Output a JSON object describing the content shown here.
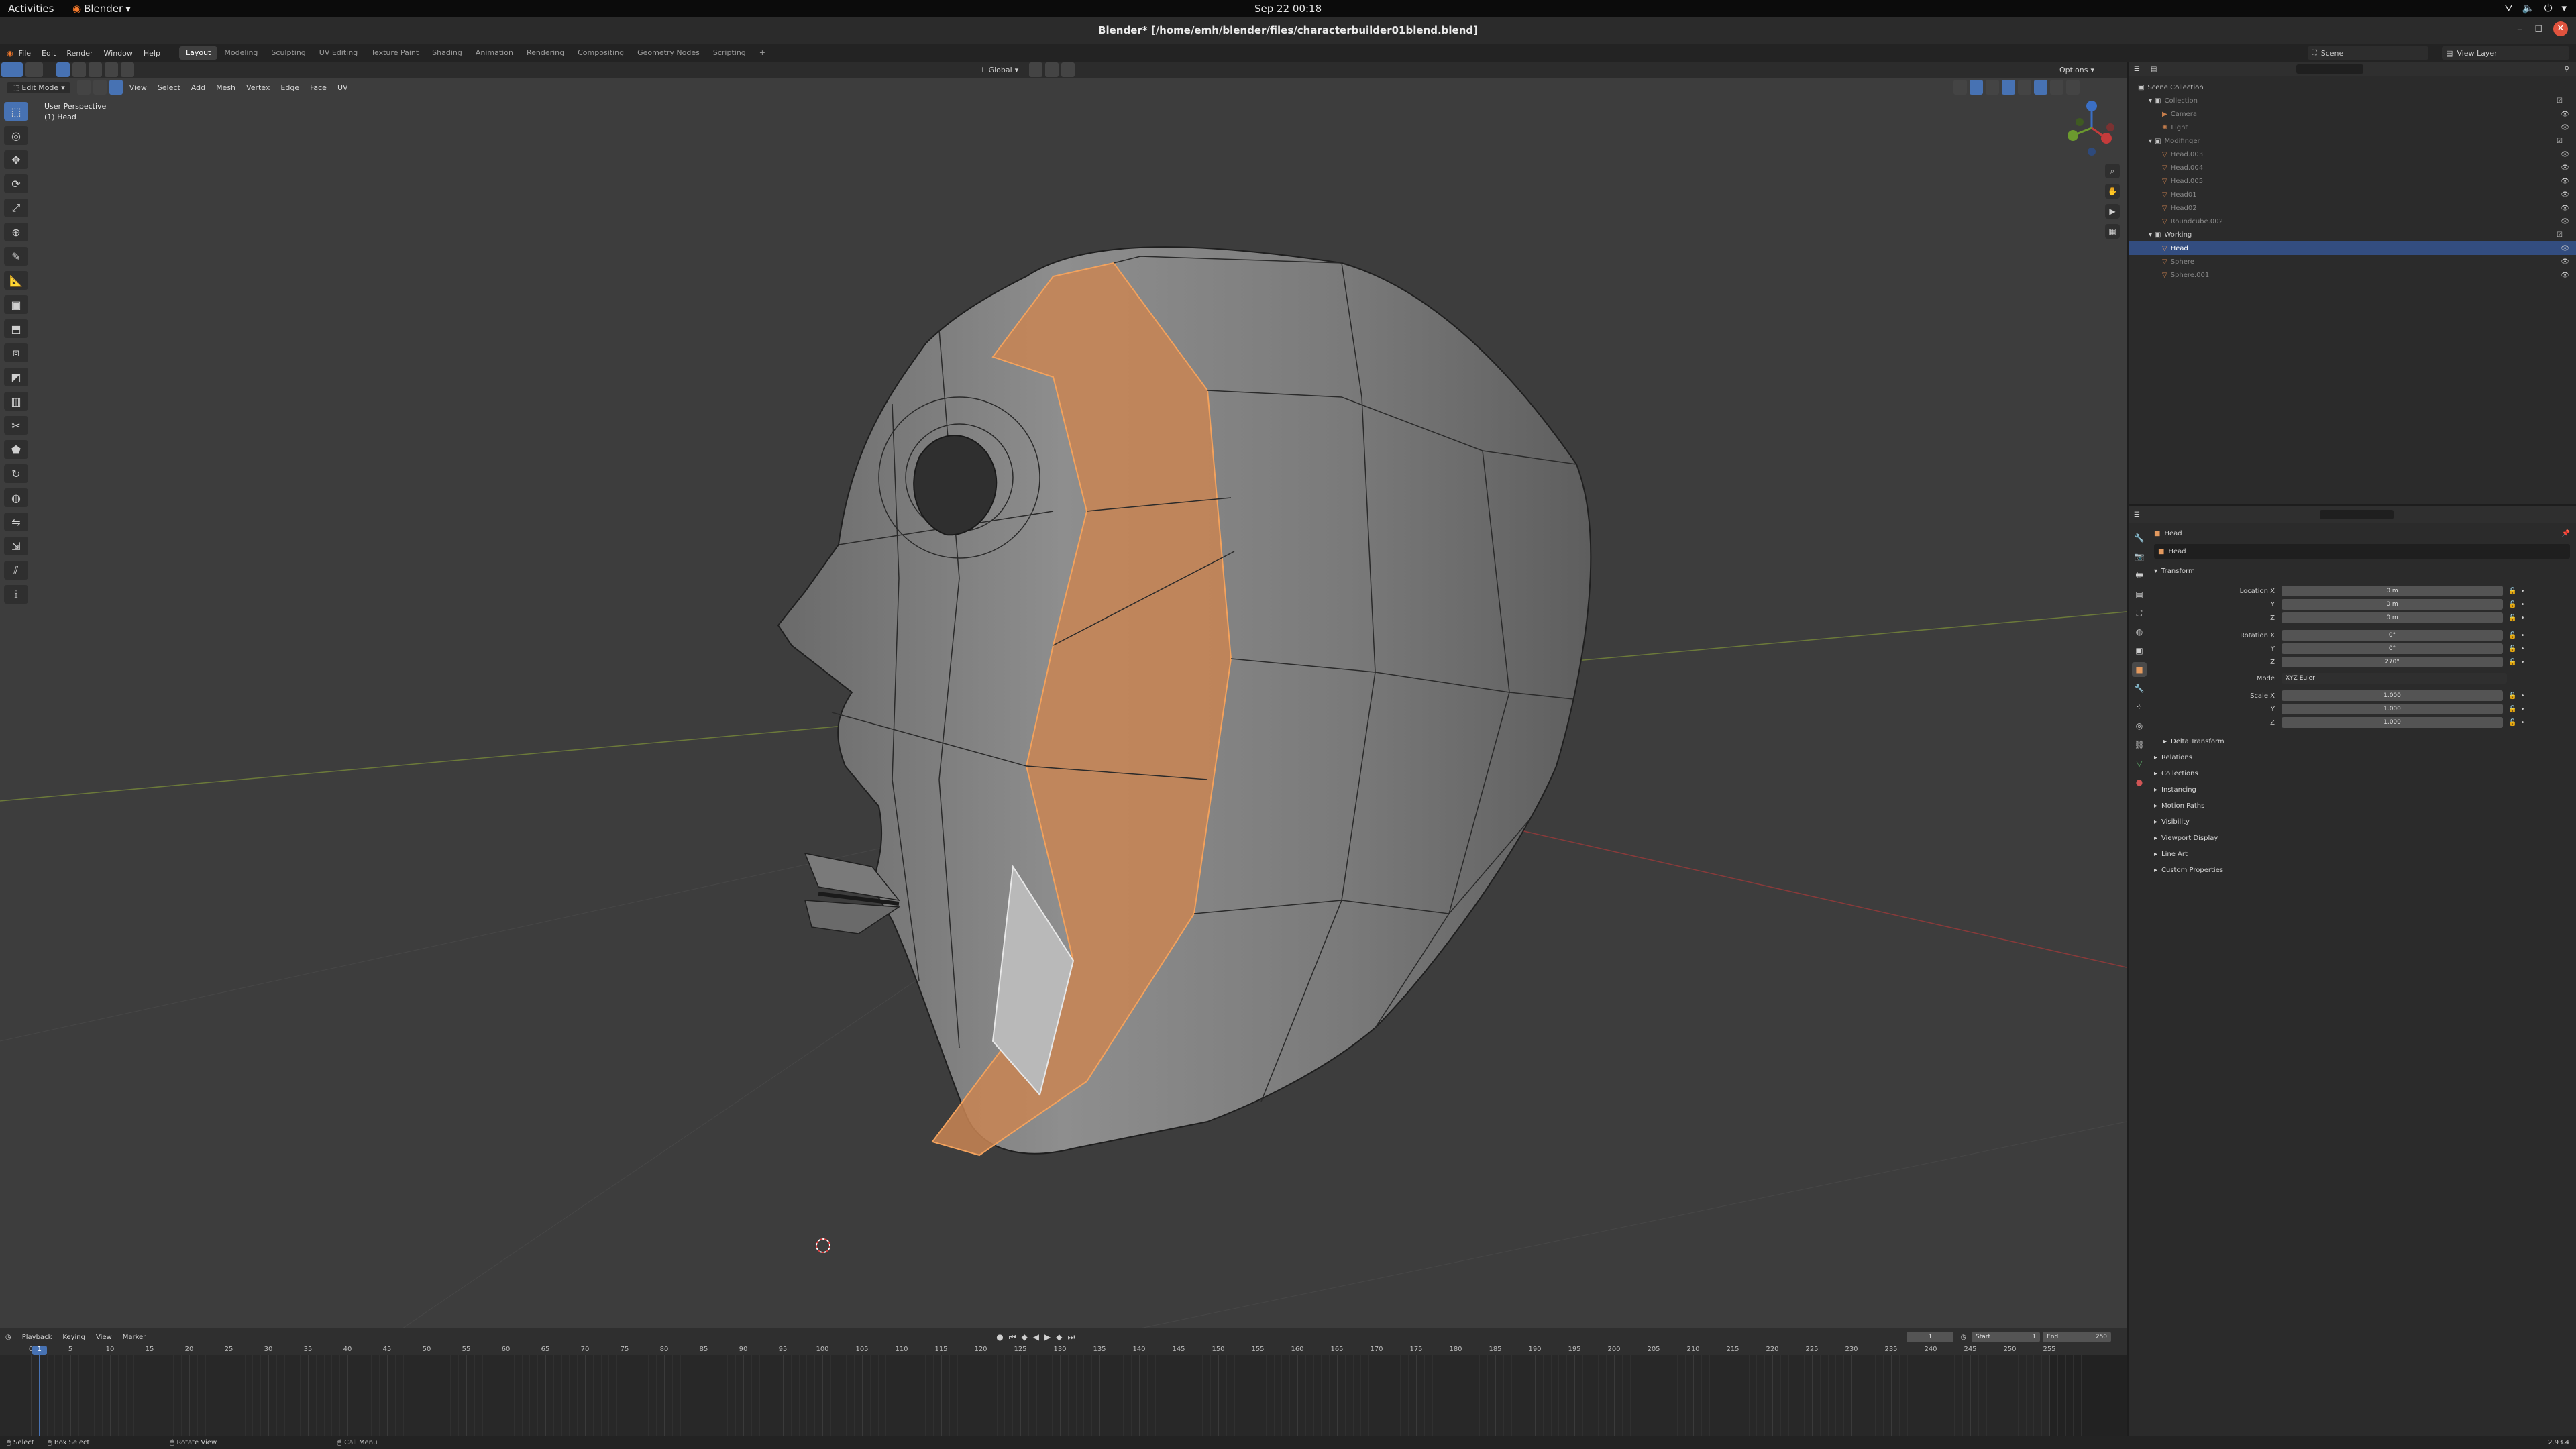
{
  "gnome": {
    "activities": "Activities",
    "app_menu": "Blender",
    "clock": "Sep 22  00:18"
  },
  "window": {
    "title": "Blender* [/home/emh/blender/files/characterbuilder01blend.blend]"
  },
  "menus": [
    "File",
    "Edit",
    "Render",
    "Window",
    "Help"
  ],
  "workspaces": [
    "Layout",
    "Modeling",
    "Sculpting",
    "UV Editing",
    "Texture Paint",
    "Shading",
    "Animation",
    "Rendering",
    "Compositing",
    "Geometry Nodes",
    "Scripting"
  ],
  "workspace_add": "+",
  "scene": {
    "scene_name": "Scene",
    "view_layer": "View Layer"
  },
  "viewport": {
    "mode": "Edit Mode",
    "menus": [
      "View",
      "Select",
      "Add",
      "Mesh",
      "Vertex",
      "Edge",
      "Face",
      "UV"
    ],
    "transform_orientation": "Global",
    "options": "Options",
    "perspective": "User Perspective",
    "object_label": "(1) Head"
  },
  "outliner": {
    "rows": [
      {
        "label": "Scene Collection",
        "indent": 0
      },
      {
        "label": "Collection",
        "indent": 1
      },
      {
        "label": "Camera",
        "indent": 2
      },
      {
        "label": "Light",
        "indent": 2
      },
      {
        "label": "Modifinger",
        "indent": 1
      },
      {
        "label": "Head.003",
        "indent": 2
      },
      {
        "label": "Head.004",
        "indent": 2
      },
      {
        "label": "Head.005",
        "indent": 2
      },
      {
        "label": "Head01",
        "indent": 2
      },
      {
        "label": "Head02",
        "indent": 2
      },
      {
        "label": "Roundcube.002",
        "indent": 2
      },
      {
        "label": "Working",
        "indent": 1
      },
      {
        "label": "Head",
        "indent": 2
      },
      {
        "label": "Sphere",
        "indent": 2
      },
      {
        "label": "Sphere.001",
        "indent": 2
      }
    ]
  },
  "properties": {
    "object_name": "Head",
    "datablock_name": "Head",
    "transform_header": "Transform",
    "location": {
      "label_x": "Location X",
      "x": "0 m",
      "y": "0 m",
      "z": "0 m"
    },
    "rotation": {
      "label_x": "Rotation X",
      "x": "0°",
      "y": "0°",
      "z": "270°"
    },
    "mode_label": "Mode",
    "mode_value": "XYZ Euler",
    "scale": {
      "label_x": "Scale X",
      "x": "1.000",
      "y": "1.000",
      "z": "1.000"
    },
    "axis_y": "Y",
    "axis_z": "Z",
    "delta_transform": "Delta Transform",
    "panels": [
      "Relations",
      "Collections",
      "Instancing",
      "Motion Paths",
      "Visibility",
      "Viewport Display",
      "Line Art",
      "Custom Properties"
    ]
  },
  "timeline": {
    "menus": [
      "Playback",
      "Keying",
      "View",
      "Marker"
    ],
    "current_frame": "1",
    "start_label": "Start",
    "start": "1",
    "end_label": "End",
    "end": "250",
    "ruler": [
      "0",
      "5",
      "10",
      "15",
      "20",
      "25",
      "30",
      "35",
      "40",
      "45",
      "50",
      "55",
      "60",
      "65",
      "70",
      "75",
      "80",
      "85",
      "90",
      "95",
      "100",
      "105",
      "110",
      "115",
      "120",
      "125",
      "130",
      "135",
      "140",
      "145",
      "150",
      "155",
      "160",
      "165",
      "170",
      "175",
      "180",
      "185",
      "190",
      "195",
      "200",
      "205",
      "210",
      "215",
      "220",
      "225",
      "230",
      "235",
      "240",
      "245",
      "250",
      "255"
    ],
    "playhead_marker": "1"
  },
  "statusbar": {
    "select": "Select",
    "box_select": "Box Select",
    "rotate_view": "Rotate View",
    "call_menu": "Call Menu",
    "version": "2.93.4"
  },
  "colors": {
    "accent": "#4772b3",
    "selected_face": "#d08a55",
    "bg_viewport": "#3d3d3d"
  }
}
